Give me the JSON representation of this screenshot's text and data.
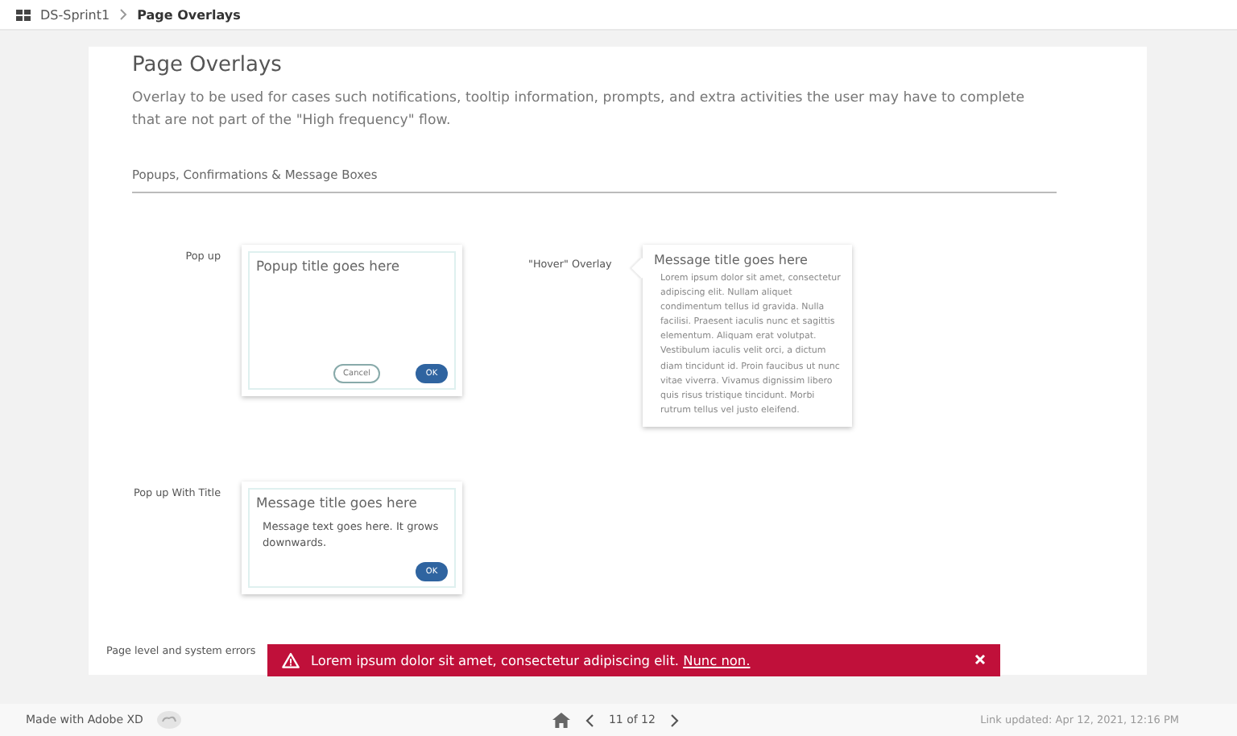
{
  "breadcrumb": {
    "project": "DS-Sprint1",
    "page": "Page Overlays"
  },
  "page": {
    "title": "Page Overlays",
    "description": "Overlay to be used for cases such notifications,  tooltip information, prompts, and extra activities the user may have to complete that are not part of the \"High frequency\" flow.",
    "section": "Popups, Confirmations & Message Boxes"
  },
  "examples": [
    {
      "kind": "popup",
      "label": "Pop up",
      "title": "Popup title goes here",
      "buttons": [
        {
          "label": "Cancel",
          "kind": "secondary"
        },
        {
          "label": "OK",
          "kind": "primary"
        }
      ]
    },
    {
      "kind": "tooltip",
      "label": "\"Hover\" Overlay",
      "title": "Message title goes here",
      "text": "Lorem ipsum dolor sit amet, consectetur adipiscing elit. Nullam aliquet condimentum tellus id gravida. Nulla facilisi. Praesent iaculis nunc et sagittis elementum. Aliquam erat volutpat. Vestibulum iaculis velit orci, a dictum diam tincidunt id. Proin faucibus ut nunc vitae viverra. Vivamus dignissim libero quis risus tristique tincidunt. Morbi rutrum tellus vel justo eleifend."
    },
    {
      "kind": "message",
      "label": "Pop up With Title",
      "title": "Message title goes here",
      "text": "Message text goes here. It grows downwards.",
      "buttons": [
        {
          "label": "OK",
          "kind": "primary"
        }
      ]
    }
  ],
  "error": {
    "label": "Page level and system errors",
    "message": "Lorem ipsum dolor sit amet, consectetur adipiscing elit.",
    "link": "Nunc non."
  },
  "footer": {
    "made_with": "Made with Adobe XD",
    "pager": "11 of 12",
    "updated": "Link updated: Apr 12, 2021, 12:16 PM"
  }
}
